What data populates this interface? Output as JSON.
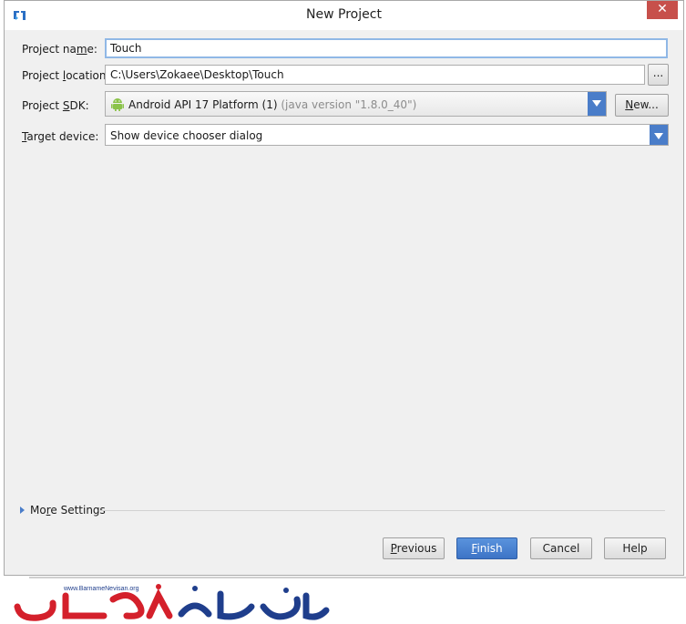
{
  "window": {
    "title": "New Project"
  },
  "form": {
    "project_name": {
      "label_pre": "Project na",
      "label_mnemonic": "m",
      "label_post": "e:",
      "value": "Touch"
    },
    "project_location": {
      "label_pre": "Project ",
      "label_mnemonic": "l",
      "label_post": "ocation:",
      "value": "C:\\Users\\Zokaee\\Desktop\\Touch",
      "browse_label": "..."
    },
    "project_sdk": {
      "label_pre": "Project ",
      "label_mnemonic": "S",
      "label_post": "DK:",
      "value": "Android API 17 Platform (1)",
      "hint": "(java version \"1.8.0_40\")",
      "new_pre": "",
      "new_mnemonic": "N",
      "new_post": "ew..."
    },
    "target_device": {
      "label_pre": "",
      "label_mnemonic": "T",
      "label_post": "arget device:",
      "value": "Show device chooser dialog"
    }
  },
  "more_settings": {
    "pre": "Mo",
    "mnemonic": "r",
    "post": "e Settings"
  },
  "buttons": {
    "previous": {
      "mnemonic": "P",
      "rest": "revious"
    },
    "finish": {
      "mnemonic": "F",
      "rest": "inish"
    },
    "cancel": "Cancel",
    "help": "Help"
  },
  "watermark": {
    "url": "www.BarnameNevisan.org"
  },
  "colors": {
    "accent": "#4a7dc9",
    "close": "#c7504b",
    "android": "#8bc34a",
    "logo_red": "#d4202b",
    "logo_blue": "#1f3e8c"
  }
}
